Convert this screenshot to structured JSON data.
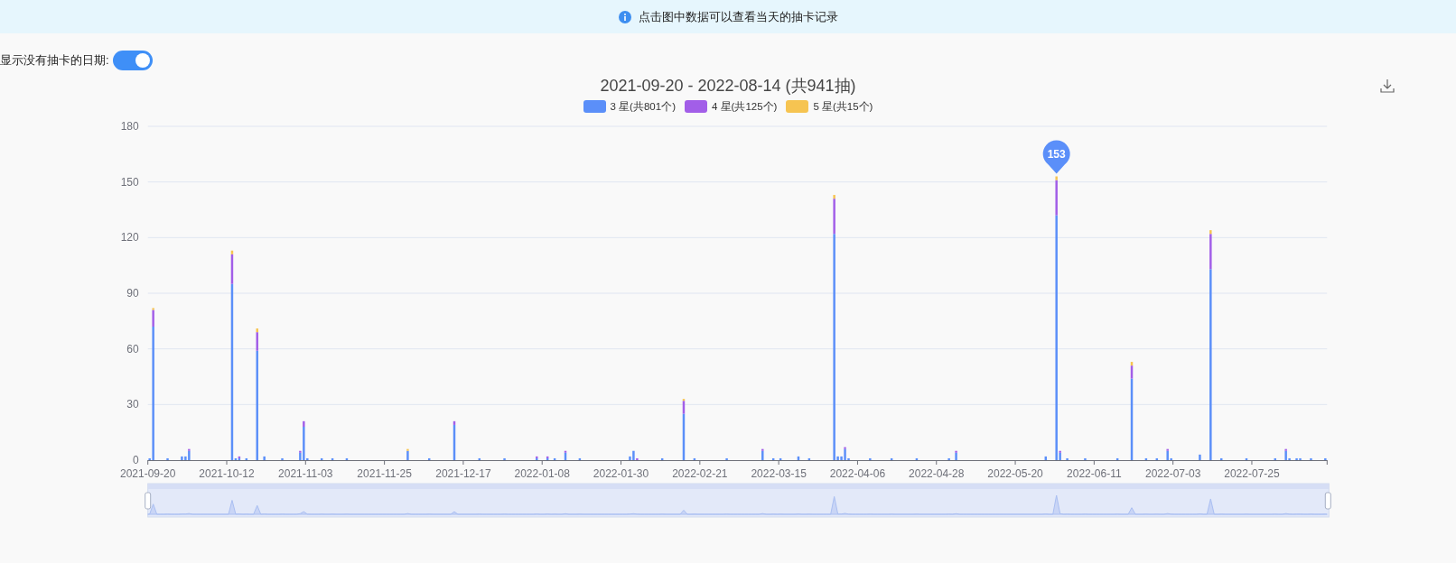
{
  "banner": {
    "text": "点击图中数据可以查看当天的抽卡记录"
  },
  "toggle": {
    "label": "显示没有抽卡的日期:",
    "on": true
  },
  "chart": {
    "chart_data": {
      "type": "bar",
      "stacked": true,
      "title": "2021-09-20 - 2022-08-14 (共941抽)",
      "categories": [
        "2021-09-20",
        null,
        null,
        null,
        null,
        null,
        null,
        null,
        null,
        null,
        null,
        null,
        null,
        null,
        null,
        null,
        null,
        null,
        null,
        null,
        null,
        null,
        "2021-10-12",
        null,
        null,
        null,
        null,
        null,
        null,
        null,
        null,
        null,
        null,
        null,
        null,
        null,
        null,
        null,
        null,
        null,
        null,
        null,
        null,
        null,
        "2021-11-03",
        null,
        null,
        null,
        null,
        null,
        null,
        null,
        null,
        null,
        null,
        null,
        null,
        null,
        null,
        null,
        null,
        null,
        null,
        null,
        null,
        null,
        "2021-11-25",
        null,
        null,
        null,
        null,
        null,
        null,
        null,
        null,
        null,
        null,
        null,
        null,
        null,
        null,
        null,
        null,
        null,
        null,
        null,
        null,
        null,
        "2021-12-17",
        null,
        null,
        null,
        null,
        null,
        null,
        null,
        null,
        null,
        null,
        null,
        null,
        null,
        null,
        null,
        null,
        null,
        null,
        null,
        null,
        null,
        "2022-01-08",
        null,
        null,
        null,
        null,
        null,
        null,
        null,
        null,
        null,
        null,
        null,
        null,
        null,
        null,
        null,
        null,
        null,
        null,
        null,
        null,
        null,
        "2022-01-30",
        null,
        null,
        null,
        null,
        null,
        null,
        null,
        null,
        null,
        null,
        null,
        null,
        null,
        null,
        null,
        null,
        null,
        null,
        null,
        null,
        null,
        "2022-02-21",
        null,
        null,
        null,
        null,
        null,
        null,
        null,
        null,
        null,
        null,
        null,
        null,
        null,
        null,
        null,
        null,
        null,
        null,
        null,
        null,
        null,
        "2022-03-15",
        null,
        null,
        null,
        null,
        null,
        null,
        null,
        null,
        null,
        null,
        null,
        null,
        null,
        null,
        null,
        null,
        null,
        null,
        null,
        null,
        null,
        "2022-04-06",
        null,
        null,
        null,
        null,
        null,
        null,
        null,
        null,
        null,
        null,
        null,
        null,
        null,
        null,
        null,
        null,
        null,
        null,
        null,
        null,
        null,
        "2022-04-28",
        null,
        null,
        null,
        null,
        null,
        null,
        null,
        null,
        null,
        null,
        null,
        null,
        null,
        null,
        null,
        null,
        null,
        null,
        null,
        null,
        null,
        "2022-05-20",
        null,
        null,
        null,
        null,
        null,
        null,
        null,
        null,
        null,
        null,
        null,
        null,
        null,
        null,
        null,
        null,
        null,
        null,
        null,
        null,
        null,
        "2022-06-11",
        null,
        null,
        null,
        null,
        null,
        null,
        null,
        null,
        null,
        null,
        null,
        null,
        null,
        null,
        null,
        null,
        null,
        null,
        null,
        null,
        null,
        "2022-07-03",
        null,
        null,
        null,
        null,
        null,
        null,
        null,
        null,
        null,
        null,
        null,
        null,
        null,
        null,
        null,
        null,
        null,
        null,
        null,
        null,
        null,
        "2022-07-25",
        null,
        null,
        null,
        null,
        null,
        null,
        null,
        null,
        null,
        null,
        null,
        null,
        null,
        null,
        null,
        null,
        null,
        null,
        null,
        null
      ],
      "series": [
        {
          "name": "3 星(共801个)",
          "color": "#5b8ff9",
          "values": [
            1,
            72,
            0,
            0,
            0,
            1,
            0,
            0,
            0,
            2,
            2,
            5,
            0,
            0,
            0,
            0,
            0,
            0,
            0,
            0,
            0,
            0,
            0,
            95,
            1,
            1,
            0,
            1,
            0,
            0,
            59,
            0,
            2,
            0,
            0,
            0,
            0,
            1,
            0,
            0,
            0,
            0,
            4,
            18,
            1,
            0,
            0,
            0,
            1,
            0,
            0,
            1,
            0,
            0,
            0,
            1,
            0,
            0,
            0,
            0,
            0,
            0,
            0,
            0,
            0,
            0,
            0,
            0,
            0,
            0,
            0,
            0,
            5,
            0,
            0,
            0,
            0,
            0,
            1,
            0,
            0,
            0,
            0,
            0,
            0,
            19,
            0,
            0,
            0,
            0,
            0,
            0,
            1,
            0,
            0,
            0,
            0,
            0,
            0,
            1,
            0,
            0,
            0,
            0,
            0,
            0,
            0,
            0,
            1,
            0,
            0,
            1,
            0,
            1,
            0,
            0,
            4,
            0,
            0,
            0,
            1,
            0,
            0,
            0,
            0,
            0,
            0,
            0,
            0,
            0,
            0,
            0,
            0,
            0,
            2,
            5,
            0,
            0,
            0,
            0,
            0,
            0,
            0,
            1,
            0,
            0,
            0,
            0,
            0,
            25,
            0,
            0,
            1,
            0,
            0,
            0,
            0,
            0,
            0,
            0,
            0,
            1,
            0,
            0,
            0,
            0,
            0,
            0,
            0,
            0,
            0,
            5,
            0,
            0,
            1,
            0,
            1,
            0,
            0,
            0,
            0,
            2,
            0,
            0,
            1,
            0,
            0,
            0,
            0,
            0,
            0,
            122,
            2,
            2,
            6,
            1,
            0,
            0,
            0,
            0,
            0,
            1,
            0,
            0,
            0,
            0,
            0,
            1,
            0,
            0,
            0,
            0,
            0,
            0,
            1,
            0,
            0,
            0,
            0,
            0,
            0,
            0,
            0,
            1,
            0,
            4,
            0,
            0,
            0,
            0,
            0,
            0,
            0,
            0,
            0,
            0,
            0,
            0,
            0,
            0,
            0,
            0,
            0,
            0,
            0,
            0,
            0,
            0,
            0,
            0,
            2,
            0,
            0,
            132,
            4,
            0,
            1,
            0,
            0,
            0,
            0,
            1,
            0,
            0,
            0,
            0,
            0,
            0,
            0,
            0,
            1,
            0,
            0,
            0,
            44,
            0,
            0,
            0,
            1,
            0,
            0,
            1,
            0,
            0,
            5,
            1,
            0,
            0,
            0,
            0,
            0,
            0,
            0,
            3,
            0,
            0,
            103,
            0,
            0,
            1,
            0,
            0,
            0,
            0,
            0,
            0,
            1,
            0,
            0,
            0,
            0,
            0,
            0,
            0,
            1,
            0,
            0,
            5,
            1,
            0,
            1,
            1,
            0,
            0,
            1,
            0,
            0,
            0,
            1
          ]
        },
        {
          "name": "4 星(共125个)",
          "color": "#a25ee8",
          "values": [
            0,
            9,
            0,
            0,
            0,
            0,
            0,
            0,
            0,
            0,
            0,
            1,
            0,
            0,
            0,
            0,
            0,
            0,
            0,
            0,
            0,
            0,
            0,
            16,
            0,
            1,
            0,
            0,
            0,
            0,
            10,
            0,
            0,
            0,
            0,
            0,
            0,
            0,
            0,
            0,
            0,
            0,
            1,
            3,
            0,
            0,
            0,
            0,
            0,
            0,
            0,
            0,
            0,
            0,
            0,
            0,
            0,
            0,
            0,
            0,
            0,
            0,
            0,
            0,
            0,
            0,
            0,
            0,
            0,
            0,
            0,
            0,
            0,
            0,
            0,
            0,
            0,
            0,
            0,
            0,
            0,
            0,
            0,
            0,
            0,
            2,
            0,
            0,
            0,
            0,
            0,
            0,
            0,
            0,
            0,
            0,
            0,
            0,
            0,
            0,
            0,
            0,
            0,
            0,
            0,
            0,
            0,
            0,
            1,
            0,
            0,
            1,
            0,
            0,
            0,
            0,
            1,
            0,
            0,
            0,
            0,
            0,
            0,
            0,
            0,
            0,
            0,
            0,
            0,
            0,
            0,
            0,
            0,
            0,
            0,
            0,
            1,
            0,
            0,
            0,
            0,
            0,
            0,
            0,
            0,
            0,
            0,
            0,
            0,
            7,
            0,
            0,
            0,
            0,
            0,
            0,
            0,
            0,
            0,
            0,
            0,
            0,
            0,
            0,
            0,
            0,
            0,
            0,
            0,
            0,
            0,
            1,
            0,
            0,
            0,
            0,
            0,
            0,
            0,
            0,
            0,
            0,
            0,
            0,
            0,
            0,
            0,
            0,
            0,
            0,
            0,
            19,
            0,
            0,
            1,
            0,
            0,
            0,
            0,
            0,
            0,
            0,
            0,
            0,
            0,
            0,
            0,
            0,
            0,
            0,
            0,
            0,
            0,
            0,
            0,
            0,
            0,
            0,
            0,
            0,
            0,
            0,
            0,
            0,
            0,
            1,
            0,
            0,
            0,
            0,
            0,
            0,
            0,
            0,
            0,
            0,
            0,
            0,
            0,
            0,
            0,
            0,
            0,
            0,
            0,
            0,
            0,
            0,
            0,
            0,
            0,
            0,
            0,
            19,
            1,
            0,
            0,
            0,
            0,
            0,
            0,
            0,
            0,
            0,
            0,
            0,
            0,
            0,
            0,
            0,
            0,
            0,
            0,
            0,
            7,
            0,
            0,
            0,
            0,
            0,
            0,
            0,
            0,
            0,
            1,
            0,
            0,
            0,
            0,
            0,
            0,
            0,
            0,
            0,
            0,
            0,
            19,
            0,
            0,
            0,
            0,
            0,
            0,
            0,
            0,
            0,
            0,
            0,
            0,
            0,
            0,
            0,
            0,
            0,
            0,
            0,
            0,
            1,
            0,
            0,
            0,
            0,
            0,
            0,
            0,
            0,
            0,
            0,
            0
          ]
        },
        {
          "name": "5 星(共15个)",
          "color": "#f6c451",
          "values": [
            0,
            1,
            0,
            0,
            0,
            0,
            0,
            0,
            0,
            0,
            0,
            0,
            0,
            0,
            0,
            0,
            0,
            0,
            0,
            0,
            0,
            0,
            0,
            2,
            0,
            0,
            0,
            0,
            0,
            0,
            2,
            0,
            0,
            0,
            0,
            0,
            0,
            0,
            0,
            0,
            0,
            0,
            0,
            0,
            0,
            0,
            0,
            0,
            0,
            0,
            0,
            0,
            0,
            0,
            0,
            0,
            0,
            0,
            0,
            0,
            0,
            0,
            0,
            0,
            0,
            0,
            0,
            0,
            0,
            0,
            0,
            0,
            1,
            0,
            0,
            0,
            0,
            0,
            0,
            0,
            0,
            0,
            0,
            0,
            0,
            0,
            0,
            0,
            0,
            0,
            0,
            0,
            0,
            0,
            0,
            0,
            0,
            0,
            0,
            0,
            0,
            0,
            0,
            0,
            0,
            0,
            0,
            0,
            0,
            0,
            0,
            0,
            0,
            0,
            0,
            0,
            0,
            0,
            0,
            0,
            0,
            0,
            0,
            0,
            0,
            0,
            0,
            0,
            0,
            0,
            0,
            0,
            0,
            0,
            0,
            0,
            0,
            0,
            0,
            0,
            0,
            0,
            0,
            0,
            0,
            0,
            0,
            0,
            0,
            1,
            0,
            0,
            0,
            0,
            0,
            0,
            0,
            0,
            0,
            0,
            0,
            0,
            0,
            0,
            0,
            0,
            0,
            0,
            0,
            0,
            0,
            0,
            0,
            0,
            0,
            0,
            0,
            0,
            0,
            0,
            0,
            0,
            0,
            0,
            0,
            0,
            0,
            0,
            0,
            0,
            0,
            2,
            0,
            0,
            0,
            0,
            0,
            0,
            0,
            0,
            0,
            0,
            0,
            0,
            0,
            0,
            0,
            0,
            0,
            0,
            0,
            0,
            0,
            0,
            0,
            0,
            0,
            0,
            0,
            0,
            0,
            0,
            0,
            0,
            0,
            0,
            0,
            0,
            0,
            0,
            0,
            0,
            0,
            0,
            0,
            0,
            0,
            0,
            0,
            0,
            0,
            0,
            0,
            0,
            0,
            0,
            0,
            0,
            0,
            0,
            0,
            0,
            0,
            2,
            0,
            0,
            0,
            0,
            0,
            0,
            0,
            0,
            0,
            0,
            0,
            0,
            0,
            0,
            0,
            0,
            0,
            0,
            0,
            0,
            2,
            0,
            0,
            0,
            0,
            0,
            0,
            0,
            0,
            0,
            0,
            0,
            0,
            0,
            0,
            0,
            0,
            0,
            0,
            0,
            0,
            0,
            2,
            0,
            0,
            0,
            0,
            0,
            0,
            0,
            0,
            0,
            0,
            0,
            0,
            0,
            0,
            0,
            0,
            0,
            0,
            0,
            0,
            0,
            0,
            0,
            0,
            0,
            0,
            0,
            0,
            0,
            0,
            0,
            0
          ]
        }
      ],
      "grid": true,
      "ylim": [
        0,
        180
      ],
      "yticks": [
        0,
        30,
        60,
        90,
        120,
        150,
        180
      ],
      "annotations": [
        "153"
      ]
    }
  }
}
